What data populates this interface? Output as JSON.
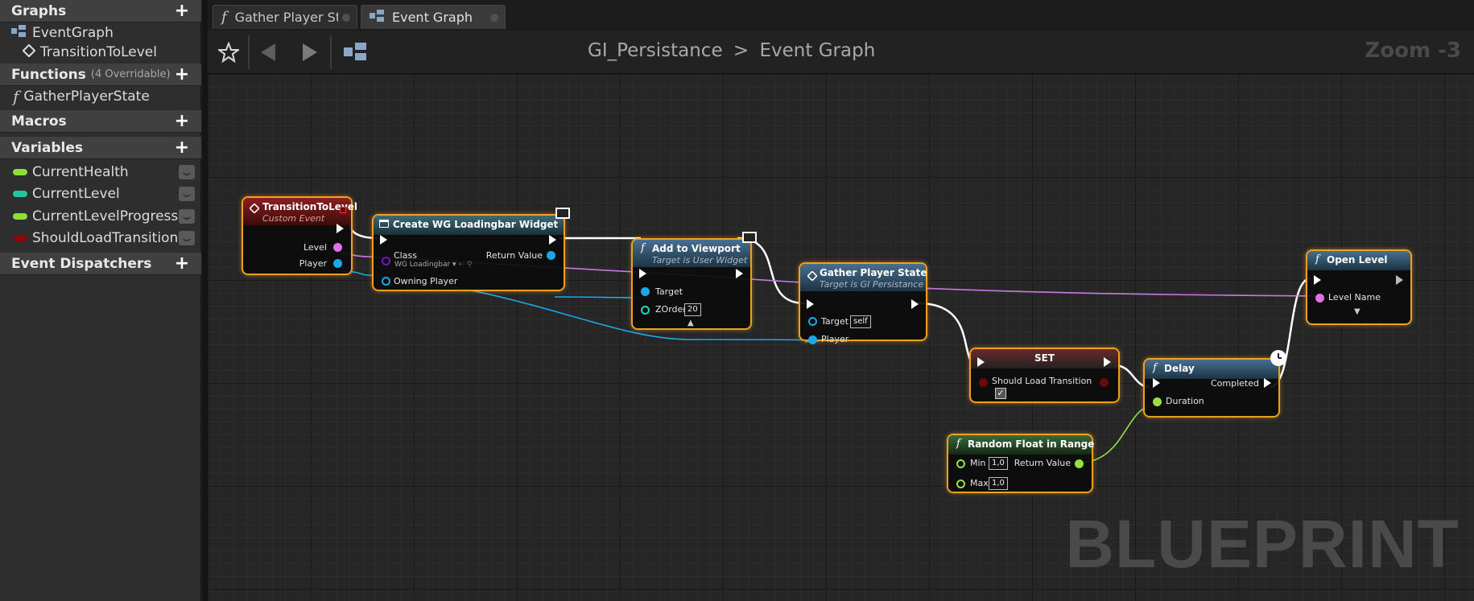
{
  "sidebar": {
    "graphs_title": "Graphs",
    "graph_items": [
      "EventGraph",
      "TransitionToLevel"
    ],
    "functions_title": "Functions",
    "functions_sub": "(4 Overridable)",
    "function_items": [
      "GatherPlayerState"
    ],
    "macros_title": "Macros",
    "variables_title": "Variables",
    "variables": [
      {
        "name": "CurrentHealth",
        "color": "#8fdc3a"
      },
      {
        "name": "CurrentLevel",
        "color": "#20c8a0"
      },
      {
        "name": "CurrentLevelProgress",
        "color": "#8fdc3a"
      },
      {
        "name": "ShouldLoadTransition",
        "color": "#8a0a0a"
      }
    ],
    "dispatchers_title": "Event Dispatchers"
  },
  "tabs": [
    {
      "label": "Gather Player State",
      "icon": "function-icon"
    },
    {
      "label": "Event Graph",
      "icon": "graph-icon"
    }
  ],
  "toolbar": {
    "breadcrumb_root": "GI_Persistance",
    "breadcrumb_sep": ">",
    "breadcrumb_current": "Event Graph",
    "zoom": "Zoom -3"
  },
  "graph": {
    "watermark": "BLUEPRINT",
    "nodes": {
      "transition": {
        "title": "TransitionToLevel",
        "subtitle": "Custom Event",
        "pins": [
          "Level",
          "Player"
        ]
      },
      "create_widget": {
        "title": "Create WG Loadingbar Widget",
        "class_label": "Class",
        "class_value": "WG Loadingbar",
        "owning": "Owning Player",
        "return": "Return Value"
      },
      "add_viewport": {
        "title": "Add to Viewport",
        "subtitle": "Target is User Widget",
        "target": "Target",
        "zorder": "ZOrder",
        "zorder_value": "20"
      },
      "gather": {
        "title": "Gather Player State",
        "subtitle": "Target is GI Persistance",
        "target": "Target",
        "target_value": "self",
        "player": "Player"
      },
      "set": {
        "title": "SET",
        "var": "Should Load Transition"
      },
      "delay": {
        "title": "Delay",
        "completed": "Completed",
        "duration": "Duration"
      },
      "random": {
        "title": "Random Float in Range",
        "min": "Min",
        "min_value": "1,0",
        "max": "Max",
        "max_value": "1,0",
        "return": "Return Value"
      },
      "open_level": {
        "title": "Open Level",
        "level_name": "Level Name"
      }
    }
  },
  "colors": {
    "exec": "#ffffff",
    "string_pin": "#e070e8",
    "object_pin": "#1aa8e8",
    "float_pin": "#98e040",
    "int_pin": "#20d8b8",
    "class_pin": "#6a18c8",
    "selected_outline": "#f0a020"
  }
}
